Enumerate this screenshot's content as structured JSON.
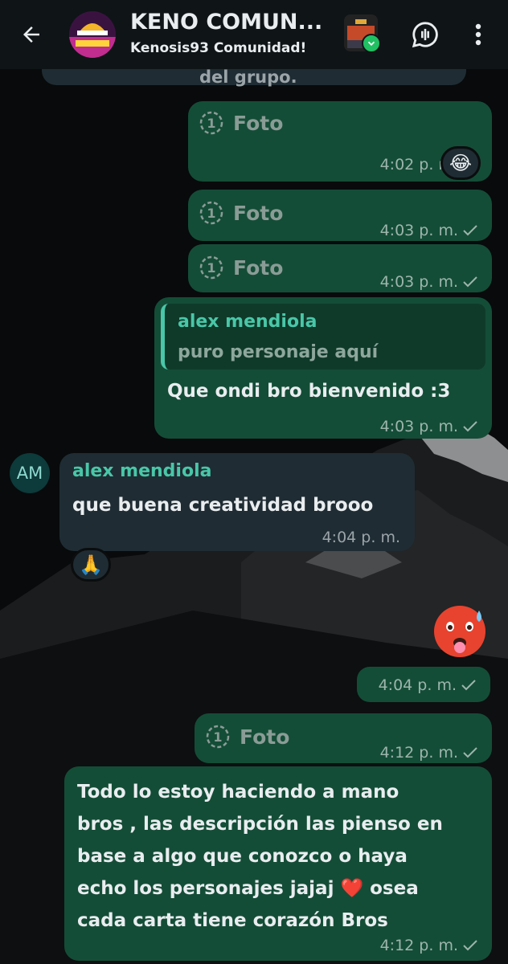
{
  "header": {
    "title": "KENO COMUN...",
    "subtitle": "Kenosis93 Comunidad!"
  },
  "colors": {
    "outgoing_bubble": "#144d37",
    "incoming_bubble": "#1f2c33",
    "accent": "#49c7a8",
    "header_bg": "#0f1417"
  },
  "messages": {
    "top_partial": "del grupo.",
    "m1": {
      "label": "Foto",
      "time": "4:02 p. m.",
      "reaction": "😂"
    },
    "m2": {
      "label": "Foto",
      "time": "4:03 p. m."
    },
    "m3": {
      "label": "Foto",
      "time": "4:03 p. m."
    },
    "m4": {
      "quote_name": "alex mendiola",
      "quote_text": "puro personaje aquí",
      "text": "Que ondi bro bienvenido :3",
      "time": "4:03 p. m."
    },
    "m5": {
      "avatar_initials": "AM",
      "sender": "alex mendiola",
      "text": "que buena creatividad brooo",
      "time": "4:04 p. m.",
      "reaction": "🙏"
    },
    "m6": {
      "emoji": "🥵",
      "time": "4:04 p. m."
    },
    "m7": {
      "label": "Foto",
      "time": "4:12 p. m."
    },
    "m8": {
      "lines": [
        "Todo lo estoy haciendo a mano",
        "bros , las descripción las pienso en",
        "base a algo que conozco o haya",
        "echo los personajes jajaj ❤️ osea",
        "cada carta tiene corazón Bros"
      ],
      "time": "4:12 p. m."
    }
  }
}
